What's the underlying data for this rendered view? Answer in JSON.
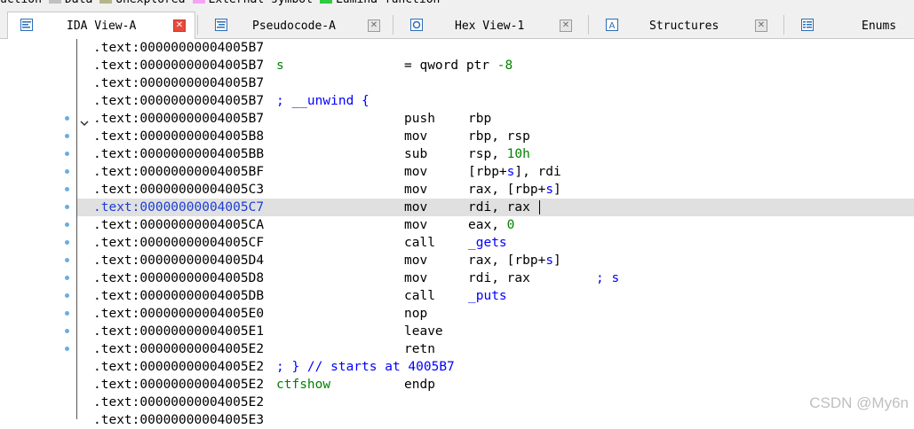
{
  "legend": [
    {
      "label": "uction",
      "color": ""
    },
    {
      "label": "Data",
      "color": "#c0c0c0"
    },
    {
      "label": "Unexplored",
      "color": "#b5b58a"
    },
    {
      "label": "External symbol",
      "color": "#f5a3f5"
    },
    {
      "label": "Lumina function",
      "color": "#2ecc40"
    }
  ],
  "tabs": [
    {
      "label": "IDA View-A",
      "icon": "ida-view-icon",
      "active": true,
      "close_color": "#e84a3c"
    },
    {
      "label": "Pseudocode-A",
      "icon": "pseudocode-icon",
      "active": false
    },
    {
      "label": "Hex View-1",
      "icon": "hex-view-icon",
      "active": false
    },
    {
      "label": "Structures",
      "icon": "structures-icon",
      "active": false
    },
    {
      "label": "Enums",
      "icon": "enums-icon",
      "active": false
    }
  ],
  "colors": {
    "address_highlight": "#1a3dd6",
    "name": "#008000",
    "comment": "#0000ff",
    "dot": "#6aaee0",
    "highlight_row": "#e0e0e0"
  },
  "lines": [
    {
      "addr": ".text:00000000004005B7"
    },
    {
      "addr": ".text:00000000004005B7",
      "name": "s",
      "equ": "= qword ptr",
      "equ_num": "-8"
    },
    {
      "addr": ".text:00000000004005B7"
    },
    {
      "addr": ".text:00000000004005B7",
      "comment": "; __unwind {"
    },
    {
      "addr": ".text:00000000004005B7",
      "mnem": "push",
      "ops": "rbp",
      "dot": true,
      "chevron": true
    },
    {
      "addr": ".text:00000000004005B8",
      "mnem": "mov",
      "ops": "rbp, rsp",
      "dot": true
    },
    {
      "addr": ".text:00000000004005BB",
      "mnem": "sub",
      "ops": "rsp, ",
      "ops_num": "10h",
      "dot": true
    },
    {
      "addr": ".text:00000000004005BF",
      "mnem": "mov",
      "ops": "[rbp+",
      "ops_name": "s",
      "ops_tail": "], rdi",
      "dot": true
    },
    {
      "addr": ".text:00000000004005C3",
      "mnem": "mov",
      "ops": "rax, [rbp+",
      "ops_name": "s",
      "ops_tail": "]",
      "dot": true
    },
    {
      "addr": ".text:00000000004005C7",
      "mnem": "mov",
      "ops": "rdi, rax",
      "dot": true,
      "highlight": true
    },
    {
      "addr": ".text:00000000004005CA",
      "mnem": "mov",
      "ops": "eax, ",
      "ops_num": "0",
      "dot": true
    },
    {
      "addr": ".text:00000000004005CF",
      "mnem": "call",
      "ops_name": "_gets",
      "dot": true
    },
    {
      "addr": ".text:00000000004005D4",
      "mnem": "mov",
      "ops": "rax, [rbp+",
      "ops_name": "s",
      "ops_tail": "]",
      "dot": true
    },
    {
      "addr": ".text:00000000004005D8",
      "mnem": "mov",
      "ops": "rdi, rax",
      "tail_comment": "; s",
      "dot": true
    },
    {
      "addr": ".text:00000000004005DB",
      "mnem": "call",
      "ops_name": "_puts",
      "dot": true
    },
    {
      "addr": ".text:00000000004005E0",
      "mnem": "nop",
      "dot": true
    },
    {
      "addr": ".text:00000000004005E1",
      "mnem": "leave",
      "dot": true
    },
    {
      "addr": ".text:00000000004005E2",
      "mnem": "retn",
      "dot": true
    },
    {
      "addr": ".text:00000000004005E2",
      "comment": "; } // starts at 4005B7"
    },
    {
      "addr": ".text:00000000004005E2",
      "name": "ctfshow",
      "mnem": "endp"
    },
    {
      "addr": ".text:00000000004005E2"
    },
    {
      "addr": ".text:00000000004005E3"
    }
  ],
  "watermark": "CSDN @My6n"
}
